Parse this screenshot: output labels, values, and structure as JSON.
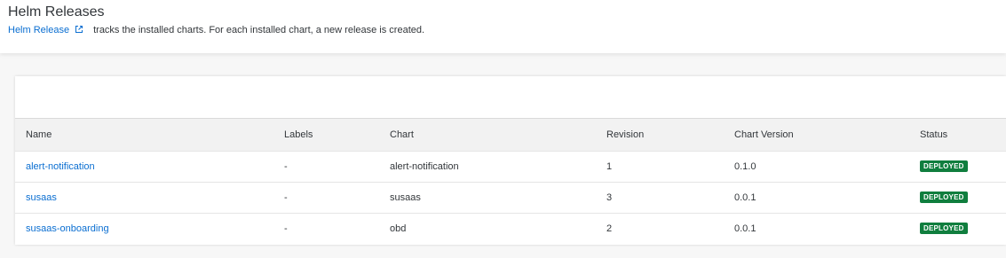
{
  "header": {
    "title": "Helm Releases",
    "link_text": "Helm Release",
    "description": "tracks the installed charts. For each installed chart, a new release is created."
  },
  "table": {
    "columns": [
      "Name",
      "Labels",
      "Chart",
      "Revision",
      "Chart Version",
      "Status"
    ],
    "rows": [
      {
        "name": "alert-notification",
        "labels": "-",
        "chart": "alert-notification",
        "revision": "1",
        "chart_version": "0.1.0",
        "status": "DEPLOYED"
      },
      {
        "name": "susaas",
        "labels": "-",
        "chart": "susaas",
        "revision": "3",
        "chart_version": "0.0.1",
        "status": "DEPLOYED"
      },
      {
        "name": "susaas-onboarding",
        "labels": "-",
        "chart": "obd",
        "revision": "2",
        "chart_version": "0.0.1",
        "status": "DEPLOYED"
      }
    ]
  },
  "icons": {
    "link_icon": "external-link-icon"
  },
  "colors": {
    "link": "#0a6ed1",
    "status_deployed": "#107e3e"
  }
}
